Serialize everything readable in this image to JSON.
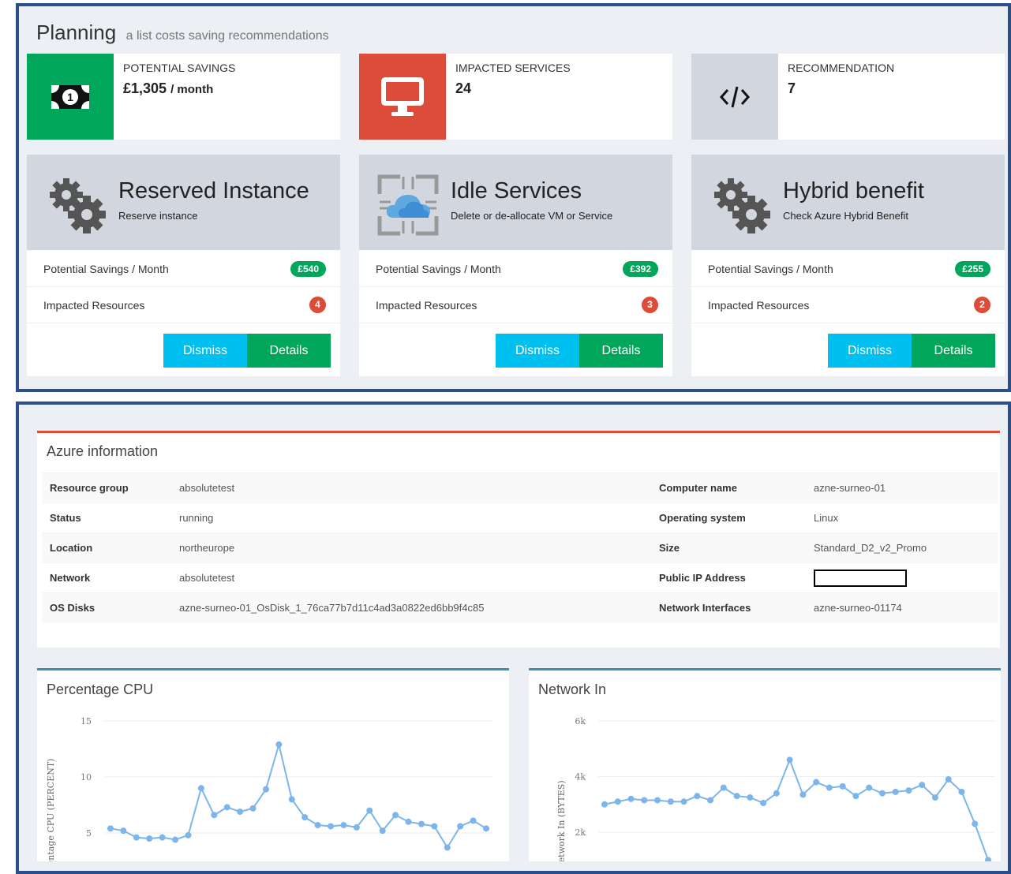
{
  "planning": {
    "title": "Planning",
    "subtitle": "a list costs saving recommendations",
    "stats": [
      {
        "label": "POTENTIAL SAVINGS",
        "value": "£1,305",
        "unit": "/ month",
        "color": "#00a65a",
        "icon": "money-icon"
      },
      {
        "label": "IMPACTED SERVICES",
        "value": "24",
        "unit": "",
        "color": "#dd4b39",
        "icon": "monitor-icon"
      },
      {
        "label": "RECOMMENDATION",
        "value": "7",
        "unit": "",
        "color": "#d2d6de",
        "icon": "code-icon"
      }
    ],
    "cards": [
      {
        "title": "Reserved Instance",
        "subtitle": "Reserve instance",
        "icon": "gears-icon",
        "savings_label": "Potential Savings / Month",
        "savings": "£540",
        "resources_label": "Impacted Resources",
        "resources": "4",
        "dismiss": "Dismiss",
        "details": "Details"
      },
      {
        "title": "Idle Services",
        "subtitle": "Delete or de-allocate VM or Service",
        "icon": "cloud-icon",
        "savings_label": "Potential Savings / Month",
        "savings": "£392",
        "resources_label": "Impacted Resources",
        "resources": "3",
        "dismiss": "Dismiss",
        "details": "Details"
      },
      {
        "title": "Hybrid benefit",
        "subtitle": "Check Azure Hybrid Benefit",
        "icon": "gears-icon",
        "savings_label": "Potential Savings / Month",
        "savings": "£255",
        "resources_label": "Impacted Resources",
        "resources": "2",
        "dismiss": "Dismiss",
        "details": "Details"
      }
    ]
  },
  "azure": {
    "title": "Azure information",
    "rows": [
      {
        "k1": "Resource group",
        "v1": "absolutetest",
        "k2": "Computer name",
        "v2": "azne-surneo-01"
      },
      {
        "k1": "Status",
        "v1": "running",
        "k2": "Operating system",
        "v2": "Linux"
      },
      {
        "k1": "Location",
        "v1": "northeurope",
        "k2": "Size",
        "v2": "Standard_D2_v2_Promo"
      },
      {
        "k1": "Network",
        "v1": "absolutetest",
        "k2": "Public IP Address",
        "v2": ""
      },
      {
        "k1": "OS Disks",
        "v1": "azne-surneo-01_OsDisk_1_76ca77b7d11c4ad3a0822ed6bb9f4c85",
        "k2": "Network Interfaces",
        "v2": "azne-surneo-01174"
      }
    ]
  },
  "chart_data": [
    {
      "type": "line",
      "title": "Percentage CPU",
      "ylabel": "Percentage CPU (PERCENT)",
      "ylim": [
        3,
        15
      ],
      "yticks": [
        "15",
        "10",
        "5"
      ],
      "color": "#7cb5ec",
      "values": [
        5.4,
        5.2,
        4.6,
        4.5,
        4.6,
        4.4,
        4.8,
        9.0,
        6.6,
        7.3,
        6.9,
        7.2,
        8.9,
        12.9,
        8.0,
        6.4,
        5.7,
        5.6,
        5.7,
        5.5,
        7.0,
        5.2,
        6.6,
        6.0,
        5.8,
        5.6,
        3.7,
        5.6,
        6.1,
        5.4
      ]
    },
    {
      "type": "line",
      "title": "Network In",
      "ylabel": "Network In (BYTES)",
      "ylim": [
        1000,
        6000
      ],
      "yticks": [
        "6k",
        "4k",
        "2k"
      ],
      "color": "#7cb5ec",
      "values": [
        3000,
        3100,
        3200,
        3150,
        3150,
        3100,
        3100,
        3300,
        3150,
        3600,
        3300,
        3250,
        3050,
        3400,
        4600,
        3350,
        3800,
        3600,
        3650,
        3300,
        3600,
        3400,
        3450,
        3500,
        3700,
        3250,
        3900,
        3450,
        2300,
        1000
      ]
    }
  ]
}
